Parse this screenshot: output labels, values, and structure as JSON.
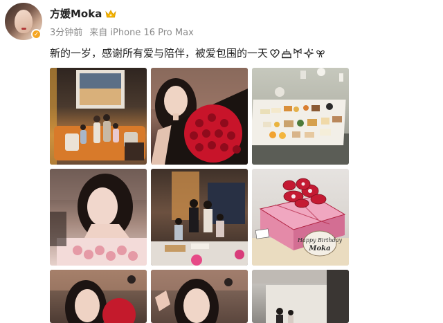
{
  "post": {
    "author_name": "方媛Moka",
    "time_ago": "3分钟前",
    "source_prefix": "来自",
    "device": "iPhone 16 Pro Max",
    "text": "新的一岁，感谢所有爱与陪伴，被爱包围的一天",
    "emojis": [
      "heart-icon",
      "cake-icon",
      "bow-icon",
      "sparkle-icon",
      "bow-icon"
    ],
    "photos": [
      {
        "name": "photo-family-living-room"
      },
      {
        "name": "photo-selfie-roses"
      },
      {
        "name": "photo-dessert-platter"
      },
      {
        "name": "photo-selfie-roses-closeup"
      },
      {
        "name": "photo-family-dinner"
      },
      {
        "name": "photo-birthday-cake"
      },
      {
        "name": "photo-selfie-partial-1"
      },
      {
        "name": "photo-selfie-partial-2"
      },
      {
        "name": "photo-lobby-partial"
      }
    ],
    "cake_card_text": "Happy Birthday Moka"
  },
  "colors": {
    "verified": "#f5a623",
    "crown": "#f5b300",
    "meta": "#8a8a8a"
  }
}
